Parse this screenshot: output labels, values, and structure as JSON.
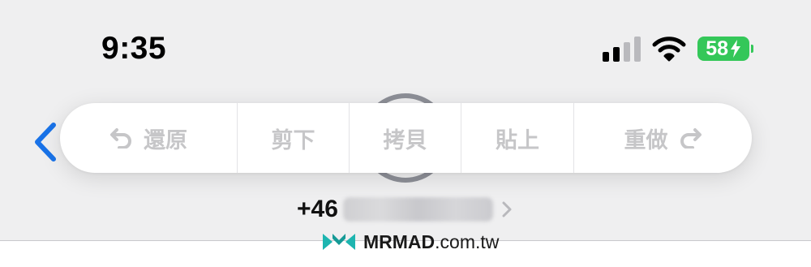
{
  "status_bar": {
    "time": "9:35",
    "battery_percent": "58",
    "signal_bars_filled": 2,
    "signal_bars_total": 4,
    "battery_color": "#34c759",
    "icons": [
      "signal-icon",
      "wifi-icon",
      "battery-charging-icon"
    ]
  },
  "edit_menu": {
    "items": [
      {
        "label": "還原",
        "icon": "undo-icon"
      },
      {
        "label": "剪下"
      },
      {
        "label": "拷貝"
      },
      {
        "label": "貼上"
      },
      {
        "label": "重做",
        "icon": "redo-icon"
      }
    ],
    "disabled_text_color": "#c6c6c8"
  },
  "navigation": {
    "back_icon": "chevron-left-icon",
    "accent_color": "#1a73e8"
  },
  "contact": {
    "phone_prefix": "+46",
    "phone_chevron_icon": "chevron-right-icon"
  },
  "watermark": {
    "brand": "MRMAD",
    "domain_suffix": ".com.tw",
    "brand_color": "#1db5b0"
  }
}
